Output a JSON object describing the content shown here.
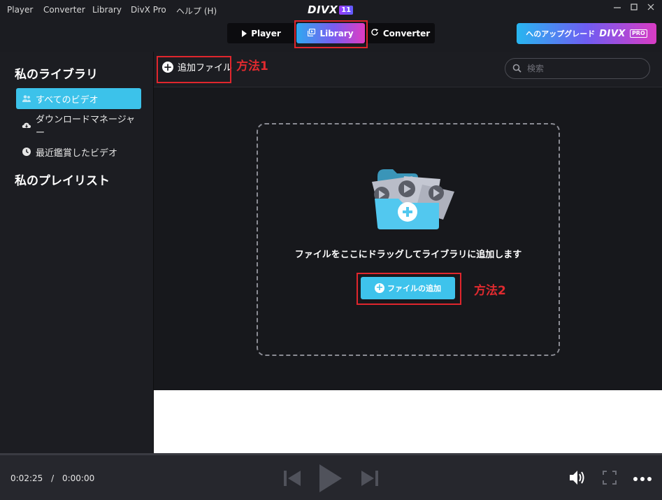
{
  "menu": {
    "player": "Player",
    "converter": "Converter",
    "library": "Library",
    "divx_pro": "DivX Pro",
    "help": "ヘルプ (H)"
  },
  "logo": {
    "word": "DIVX",
    "version": "11"
  },
  "modes": {
    "player": "Player",
    "library": "Library",
    "converter": "Converter",
    "active": "Library"
  },
  "upgrade": {
    "label": "へのアップグレード",
    "brand": "DIVX",
    "pro": "PRO"
  },
  "sidebar": {
    "library_heading": "私のライブラリ",
    "items": [
      {
        "label": "すべてのビデオ",
        "icon": "people-icon",
        "active": true
      },
      {
        "label": "ダウンロードマネージャー",
        "icon": "cloud-download-icon",
        "active": false
      },
      {
        "label": "最近鑑賞したビデオ",
        "icon": "clock-icon",
        "active": false
      }
    ],
    "playlist_heading": "私のプレイリスト"
  },
  "toolbar": {
    "add_file_label": "追加ファイル"
  },
  "search": {
    "placeholder": "検索",
    "value": ""
  },
  "annotations": {
    "method1": "方法1",
    "method2": "方法2"
  },
  "dropzone": {
    "message": "ファイルをここにドラッグしてライブラリに追加します",
    "add_button_label": "ファイルの追加"
  },
  "player": {
    "current_time": "0:02:25",
    "separator": "/",
    "total_time": "0:00:00"
  },
  "colors": {
    "accent_cyan": "#3cc2ea",
    "gradient_start": "#2fa9f0",
    "gradient_end": "#e03cc2",
    "annotation_red": "#e0262d",
    "background": "#1c1d22"
  }
}
